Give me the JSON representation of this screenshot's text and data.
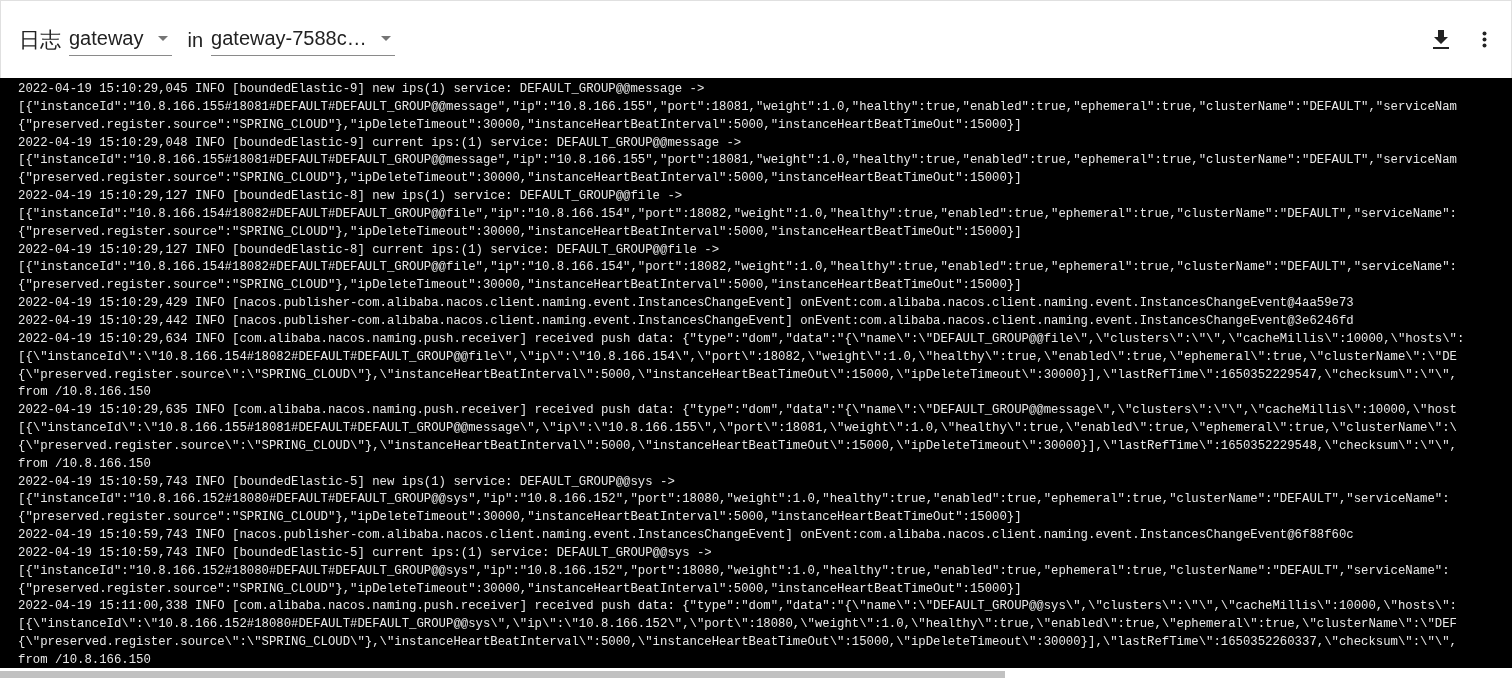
{
  "header": {
    "title": "日志",
    "container_select": {
      "value": "gateway"
    },
    "connector": "in",
    "pod_select": {
      "value": "gateway-7588c…"
    }
  },
  "log_lines": [
    "2022-04-19 15:10:29,045 INFO [boundedElastic-9] new ips(1) service: DEFAULT_GROUP@@message ->",
    "[{\"instanceId\":\"10.8.166.155#18081#DEFAULT#DEFAULT_GROUP@@message\",\"ip\":\"10.8.166.155\",\"port\":18081,\"weight\":1.0,\"healthy\":true,\"enabled\":true,\"ephemeral\":true,\"clusterName\":\"DEFAULT\",\"serviceNam",
    "{\"preserved.register.source\":\"SPRING_CLOUD\"},\"ipDeleteTimeout\":30000,\"instanceHeartBeatInterval\":5000,\"instanceHeartBeatTimeOut\":15000}]",
    "2022-04-19 15:10:29,048 INFO [boundedElastic-9] current ips:(1) service: DEFAULT_GROUP@@message ->",
    "[{\"instanceId\":\"10.8.166.155#18081#DEFAULT#DEFAULT_GROUP@@message\",\"ip\":\"10.8.166.155\",\"port\":18081,\"weight\":1.0,\"healthy\":true,\"enabled\":true,\"ephemeral\":true,\"clusterName\":\"DEFAULT\",\"serviceNam",
    "{\"preserved.register.source\":\"SPRING_CLOUD\"},\"ipDeleteTimeout\":30000,\"instanceHeartBeatInterval\":5000,\"instanceHeartBeatTimeOut\":15000}]",
    "2022-04-19 15:10:29,127 INFO [boundedElastic-8] new ips(1) service: DEFAULT_GROUP@@file ->",
    "[{\"instanceId\":\"10.8.166.154#18082#DEFAULT#DEFAULT_GROUP@@file\",\"ip\":\"10.8.166.154\",\"port\":18082,\"weight\":1.0,\"healthy\":true,\"enabled\":true,\"ephemeral\":true,\"clusterName\":\"DEFAULT\",\"serviceName\":",
    "{\"preserved.register.source\":\"SPRING_CLOUD\"},\"ipDeleteTimeout\":30000,\"instanceHeartBeatInterval\":5000,\"instanceHeartBeatTimeOut\":15000}]",
    "2022-04-19 15:10:29,127 INFO [boundedElastic-8] current ips:(1) service: DEFAULT_GROUP@@file ->",
    "[{\"instanceId\":\"10.8.166.154#18082#DEFAULT#DEFAULT_GROUP@@file\",\"ip\":\"10.8.166.154\",\"port\":18082,\"weight\":1.0,\"healthy\":true,\"enabled\":true,\"ephemeral\":true,\"clusterName\":\"DEFAULT\",\"serviceName\":",
    "{\"preserved.register.source\":\"SPRING_CLOUD\"},\"ipDeleteTimeout\":30000,\"instanceHeartBeatInterval\":5000,\"instanceHeartBeatTimeOut\":15000}]",
    "2022-04-19 15:10:29,429 INFO [nacos.publisher-com.alibaba.nacos.client.naming.event.InstancesChangeEvent] onEvent:com.alibaba.nacos.client.naming.event.InstancesChangeEvent@4aa59e73",
    "2022-04-19 15:10:29,442 INFO [nacos.publisher-com.alibaba.nacos.client.naming.event.InstancesChangeEvent] onEvent:com.alibaba.nacos.client.naming.event.InstancesChangeEvent@3e6246fd",
    "2022-04-19 15:10:29,634 INFO [com.alibaba.nacos.naming.push.receiver] received push data: {\"type\":\"dom\",\"data\":\"{\\\"name\\\":\\\"DEFAULT_GROUP@@file\\\",\\\"clusters\\\":\\\"\\\",\\\"cacheMillis\\\":10000,\\\"hosts\\\":",
    "[{\\\"instanceId\\\":\\\"10.8.166.154#18082#DEFAULT#DEFAULT_GROUP@@file\\\",\\\"ip\\\":\\\"10.8.166.154\\\",\\\"port\\\":18082,\\\"weight\\\":1.0,\\\"healthy\\\":true,\\\"enabled\\\":true,\\\"ephemeral\\\":true,\\\"clusterName\\\":\\\"DE",
    "{\\\"preserved.register.source\\\":\\\"SPRING_CLOUD\\\"},\\\"instanceHeartBeatInterval\\\":5000,\\\"instanceHeartBeatTimeOut\\\":15000,\\\"ipDeleteTimeout\\\":30000}],\\\"lastRefTime\\\":1650352229547,\\\"checksum\\\":\\\"\\\",",
    "from /10.8.166.150",
    "2022-04-19 15:10:29,635 INFO [com.alibaba.nacos.naming.push.receiver] received push data: {\"type\":\"dom\",\"data\":\"{\\\"name\\\":\\\"DEFAULT_GROUP@@message\\\",\\\"clusters\\\":\\\"\\\",\\\"cacheMillis\\\":10000,\\\"host",
    "[{\\\"instanceId\\\":\\\"10.8.166.155#18081#DEFAULT#DEFAULT_GROUP@@message\\\",\\\"ip\\\":\\\"10.8.166.155\\\",\\\"port\\\":18081,\\\"weight\\\":1.0,\\\"healthy\\\":true,\\\"enabled\\\":true,\\\"ephemeral\\\":true,\\\"clusterName\\\":\\",
    "{\\\"preserved.register.source\\\":\\\"SPRING_CLOUD\\\"},\\\"instanceHeartBeatInterval\\\":5000,\\\"instanceHeartBeatTimeOut\\\":15000,\\\"ipDeleteTimeout\\\":30000}],\\\"lastRefTime\\\":1650352229548,\\\"checksum\\\":\\\"\\\",",
    "from /10.8.166.150",
    "2022-04-19 15:10:59,743 INFO [boundedElastic-5] new ips(1) service: DEFAULT_GROUP@@sys ->",
    "[{\"instanceId\":\"10.8.166.152#18080#DEFAULT#DEFAULT_GROUP@@sys\",\"ip\":\"10.8.166.152\",\"port\":18080,\"weight\":1.0,\"healthy\":true,\"enabled\":true,\"ephemeral\":true,\"clusterName\":\"DEFAULT\",\"serviceName\":",
    "{\"preserved.register.source\":\"SPRING_CLOUD\"},\"ipDeleteTimeout\":30000,\"instanceHeartBeatInterval\":5000,\"instanceHeartBeatTimeOut\":15000}]",
    "2022-04-19 15:10:59,743 INFO [nacos.publisher-com.alibaba.nacos.client.naming.event.InstancesChangeEvent] onEvent:com.alibaba.nacos.client.naming.event.InstancesChangeEvent@6f88f60c",
    "2022-04-19 15:10:59,743 INFO [boundedElastic-5] current ips:(1) service: DEFAULT_GROUP@@sys ->",
    "[{\"instanceId\":\"10.8.166.152#18080#DEFAULT#DEFAULT_GROUP@@sys\",\"ip\":\"10.8.166.152\",\"port\":18080,\"weight\":1.0,\"healthy\":true,\"enabled\":true,\"ephemeral\":true,\"clusterName\":\"DEFAULT\",\"serviceName\":",
    "{\"preserved.register.source\":\"SPRING_CLOUD\"},\"ipDeleteTimeout\":30000,\"instanceHeartBeatInterval\":5000,\"instanceHeartBeatTimeOut\":15000}]",
    "2022-04-19 15:11:00,338 INFO [com.alibaba.nacos.naming.push.receiver] received push data: {\"type\":\"dom\",\"data\":\"{\\\"name\\\":\\\"DEFAULT_GROUP@@sys\\\",\\\"clusters\\\":\\\"\\\",\\\"cacheMillis\\\":10000,\\\"hosts\\\":",
    "[{\\\"instanceId\\\":\\\"10.8.166.152#18080#DEFAULT#DEFAULT_GROUP@@sys\\\",\\\"ip\\\":\\\"10.8.166.152\\\",\\\"port\\\":18080,\\\"weight\\\":1.0,\\\"healthy\\\":true,\\\"enabled\\\":true,\\\"ephemeral\\\":true,\\\"clusterName\\\":\\\"DEF",
    "{\\\"preserved.register.source\\\":\\\"SPRING_CLOUD\\\"},\\\"instanceHeartBeatInterval\\\":5000,\\\"instanceHeartBeatTimeOut\\\":15000,\\\"ipDeleteTimeout\\\":30000}],\\\"lastRefTime\\\":1650352260337,\\\"checksum\\\":\\\"\\\",",
    "from /10.8.166.150"
  ]
}
